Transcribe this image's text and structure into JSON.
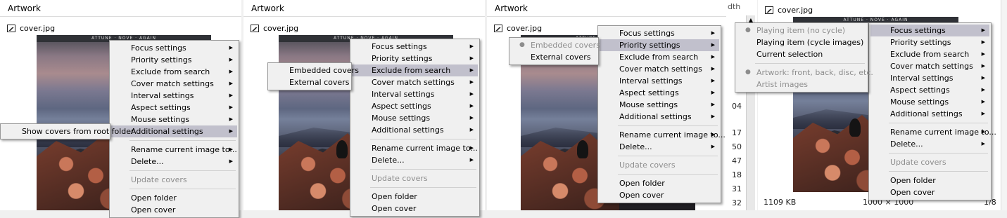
{
  "panels": {
    "title": "Artwork",
    "file": "cover.jpg",
    "art_strip": "ATTUNE · NOVE · AGAIN"
  },
  "menu_main": [
    {
      "label": "Focus settings",
      "sub": true
    },
    {
      "label": "Priority settings",
      "sub": true
    },
    {
      "label": "Exclude from search",
      "sub": true
    },
    {
      "label": "Cover match settings",
      "sub": true
    },
    {
      "label": "Interval settings",
      "sub": true
    },
    {
      "label": "Aspect settings",
      "sub": true
    },
    {
      "label": "Mouse settings",
      "sub": true
    },
    {
      "label": "Additional settings",
      "sub": true
    },
    {
      "sep": true
    },
    {
      "label": "Rename current image to...",
      "sub": true
    },
    {
      "label": "Delete...",
      "sub": true
    },
    {
      "sep": true
    },
    {
      "label": "Update covers",
      "disabled": true
    },
    {
      "sep": true
    },
    {
      "label": "Open folder"
    },
    {
      "label": "Open cover"
    }
  ],
  "menu_main_short": [
    {
      "label": "Focus settings",
      "sub": true
    },
    {
      "label": "Priority settings",
      "sub": true
    },
    {
      "label": "Exclude from search",
      "sub": true
    },
    {
      "label": "Cover match settings",
      "sub": true
    },
    {
      "label": "Interval settings",
      "sub": true
    },
    {
      "label": "Aspect settings",
      "sub": true
    },
    {
      "label": "Mouse settings",
      "sub": true
    },
    {
      "label": "Additional settings",
      "sub": true
    },
    {
      "sep": true
    },
    {
      "label": "Rename current image to...",
      "sub": true
    },
    {
      "label": "Delete...",
      "sub": true
    },
    {
      "sep": true
    },
    {
      "label": "Update covers",
      "disabled": true
    },
    {
      "sep": true
    },
    {
      "label": "Open folder"
    },
    {
      "label": "Open cover"
    }
  ],
  "submenu_additional": [
    "Show covers from root folder"
  ],
  "submenu_exclude": [
    "Embedded covers",
    "External covers"
  ],
  "submenu_priority": [
    {
      "label": "Embedded covers",
      "bullet": true,
      "disabled": true
    },
    {
      "label": "External covers"
    }
  ],
  "submenu_focus": [
    {
      "label": "Playing item (no cycle)",
      "bullet": true,
      "disabled": true
    },
    {
      "label": "Playing item (cycle images)"
    },
    {
      "label": "Current selection"
    },
    {
      "sep": true
    },
    {
      "label": "Artwork: front, back, disc, etc.",
      "bullet": true,
      "disabled": true
    },
    {
      "label": "Artist images",
      "disabled": true
    }
  ],
  "side_numbers": [
    "04",
    "17",
    "50",
    "47",
    "18",
    "31",
    "32"
  ],
  "side_label": "dth",
  "status": {
    "size": "1109 KB",
    "dims": "1000 × 1000",
    "page": "1/8"
  },
  "colors": {
    "highlight": "#c1c0cc",
    "menu_bg": "#f0f0f0",
    "disabled": "#8d8d8d"
  }
}
